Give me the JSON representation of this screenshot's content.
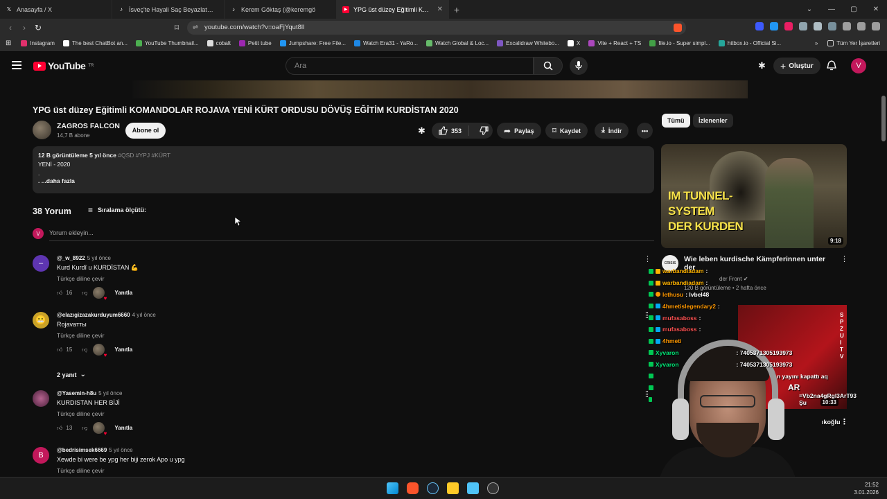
{
  "browser": {
    "tabs": [
      {
        "title": "Anasayfa / X",
        "icon": "x-logo-icon",
        "active": false
      },
      {
        "title": "İsveç'te Hayali Saç Beyazlatmanın Hil",
        "icon": "tiktok-icon",
        "active": false
      },
      {
        "title": "Kerem Göktaş (@keremgö",
        "icon": "tiktok-icon",
        "active": false
      },
      {
        "title": "YPG üst düzey Eğitimli KOMAND",
        "icon": "youtube-icon",
        "active": true
      }
    ],
    "url": "youtube.com/watch?v=oaFjYqut8lI",
    "bookmarks": [
      {
        "label": "Instagram",
        "color": "#e1306c"
      },
      {
        "label": "The best ChatBot an...",
        "color": "#ffffff"
      },
      {
        "label": "YouTube Thumbnail...",
        "color": "#4caf50"
      },
      {
        "label": "cobalt",
        "color": "#dddddd"
      },
      {
        "label": "Petit tube",
        "color": "#9c27b0"
      },
      {
        "label": "Jumpshare: Free File...",
        "color": "#2196f3"
      },
      {
        "label": "Watch Era31 - YaRo...",
        "color": "#1e88e5"
      },
      {
        "label": "Watch Global & Loc...",
        "color": "#66bb6a"
      },
      {
        "label": "Excalidraw Whitebo...",
        "color": "#7e57c2"
      },
      {
        "label": "X",
        "color": "#ffffff"
      },
      {
        "label": "Vite + React + TS",
        "color": "#ab47bc"
      },
      {
        "label": "file.io - Super simpl...",
        "color": "#43a047"
      },
      {
        "label": "hitbox.io - Official Si...",
        "color": "#26a69a"
      }
    ],
    "bookmarks_other": "Tüm Yer İşaretleri"
  },
  "youtube": {
    "logo_text": "YouTube",
    "logo_region": "TR",
    "search_placeholder": "Ara",
    "create_label": "Oluştur",
    "user_initial": "V"
  },
  "video": {
    "title": "YPG üst düzey Eğitimli KOMANDOLAR ROJAVA YENİ KÜRT ORDUSU DÖVÜŞ EĞİTİM KURDİSTAN 2020",
    "channel_name": "ZAGROS FALCON",
    "subscribers": "14,7 B abone",
    "subscribe_label": "Abone ol",
    "likes": "353",
    "share_label": "Paylaş",
    "save_label": "Kaydet",
    "download_label": "İndir",
    "description": {
      "views_time": "12 B görüntüleme  5 yıl önce",
      "tags": "#QSD #YPJ #KÜRT",
      "line1": "YENİ - 2020",
      "line2": ".",
      "more": ". ...daha fazla"
    }
  },
  "comments": {
    "count_label": "38 Yorum",
    "sort_label": "Sıralama ölçütü:",
    "add_placeholder": "Yorum ekleyin...",
    "translate_label": "Türkçe diline çevir",
    "reply_label": "Yanıtla",
    "items": [
      {
        "author": "@_w_8922",
        "time": "5 yıl önce",
        "text": "Kurd Kurdî u KURDİSTAN 💪",
        "likes": "16",
        "avatar_letter": "–",
        "avatar_color": "#5e35b1"
      },
      {
        "author": "@elazıgizazakurduyum6660",
        "time": "4 yıl önce",
        "text": "Rojavaтты",
        "likes": "15",
        "avatar_letter": "😬",
        "avatar_color": "#c9a227"
      },
      {
        "author": "@Yasemin-h8u",
        "time": "5 yıl önce",
        "text": "KURDISTAN HER BİJİ",
        "likes": "13",
        "avatar_letter": "",
        "avatar_color": "#7b3d6b"
      },
      {
        "author": "@bedrisimsek6669",
        "time": "5 yıl önce",
        "text": "Xewde bi were be ypg her biji zerok Apo u ypg",
        "likes": "",
        "avatar_letter": "B",
        "avatar_color": "#c2185b"
      }
    ],
    "replies_label": "2 yanıt"
  },
  "sidebar": {
    "chips": [
      "Tümü",
      "İzlenenler"
    ],
    "rec1": {
      "thumb_text_line1": "IM TUNNEL-",
      "thumb_text_line2": "SYSTEM",
      "thumb_text_line3": "DER KURDEN",
      "duration": "9:18",
      "title": "Wie leben kurdische Kämpferinnen unter der",
      "channel_avatar_text": "CRISIS",
      "meta": "120 B görüntüleme • 2 hafta önce",
      "channel_fragment": "der Front"
    },
    "rec2": {
      "duration": "10:33",
      "channel_fragment": "ıkoğlu"
    }
  },
  "stream_chat": [
    {
      "name": "warbandiadam",
      "msg": ":",
      "color": "#ffb300"
    },
    {
      "name": "warbandiadam",
      "msg": ":",
      "color": "#ffb300"
    },
    {
      "name": "lethusu",
      "msg": ": lvbel48",
      "color": "#ff9800"
    },
    {
      "name": "4hmetislegendary2",
      "msg": ":",
      "color": "#ff9800"
    },
    {
      "name": "mufasaboss",
      "msg": ":",
      "color": "#ff5252"
    },
    {
      "name": "mufasaboss",
      "msg": ":",
      "color": "#ff5252"
    },
    {
      "name": "4hmeti",
      "msg": "",
      "color": "#ff9800"
    },
    {
      "name": "Xyvaron",
      "msg": ": 7405371305193973",
      "color": "#00e676"
    },
    {
      "name": "Xyvaron",
      "msg": ": 7405371305193973",
      "color": "#00e676"
    },
    {
      "name": "",
      "msg": "n yayını kapattı aq",
      "color": "#00e676"
    },
    {
      "name": "",
      "msg": "AR",
      "color": "#ffffff"
    },
    {
      "name": "",
      "msg": "=Vb2na4gRgl3ArT93 Şu",
      "color": "#ffffff"
    }
  ],
  "taskbar": {
    "time": "21:52",
    "date": "3.01.2026"
  }
}
